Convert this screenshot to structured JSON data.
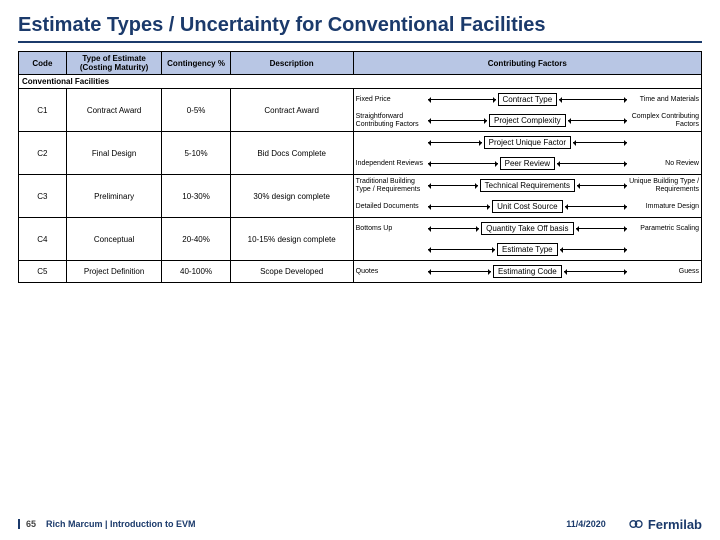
{
  "slide": {
    "title": "Estimate Types / Uncertainty for Conventional Facilities",
    "table": {
      "headers": [
        "Code",
        "Type of Estimate (Costing Maturity)",
        "Contingency %",
        "Description",
        "Contributing Factors"
      ],
      "section_heading": "Conventional Facilities",
      "rows": [
        {
          "code": "C1",
          "type": "Contract Award",
          "cont": "0-5%",
          "desc": "Contract Award"
        },
        {
          "code": "C2",
          "type": "Final Design",
          "cont": "5-10%",
          "desc": "Bid Docs Complete"
        },
        {
          "code": "C3",
          "type": "Preliminary",
          "cont": "10-30%",
          "desc": "30% design complete"
        },
        {
          "code": "C4",
          "type": "Conceptual",
          "cont": "20-40%",
          "desc": "10-15% design complete"
        },
        {
          "code": "C5",
          "type": "Project Definition",
          "cont": "40-100%",
          "desc": "Scope Developed"
        }
      ],
      "factor_rows": [
        {
          "label_left": "Fixed Price",
          "label_right": "Time and Materials",
          "mid": "Contract Type"
        },
        {
          "label_left": "Straightforward Contributing Factors",
          "label_right": "Complex Contributing Factors",
          "mid": "Project Complexity"
        },
        {
          "label_left": "",
          "label_right": "",
          "mid": "Project Unique Factor"
        },
        {
          "label_left": "Independent Reviews",
          "label_right": "No Review",
          "mid": "Peer Review"
        },
        {
          "label_left": "Traditional Building Type / Requirements",
          "label_right": "Unique Building Type / Requirements",
          "mid": "Technical Requirements"
        },
        {
          "label_left": "Detailed Documents",
          "label_right": "Immature Design",
          "mid": "Unit Cost Source"
        },
        {
          "label_left": "Bottoms Up",
          "label_right": "Parametric Scaling",
          "mid": "Quantity Take Off basis"
        },
        {
          "label_left": "",
          "label_right": "",
          "mid": "Estimate Type"
        },
        {
          "label_left": "Quotes",
          "label_right": "Guess",
          "mid": "Estimating Code"
        }
      ]
    }
  },
  "footer": {
    "page": "65",
    "presenter": "Rich Marcum | Introduction to EVM",
    "date": "11/4/2020",
    "brand": "Fermilab"
  }
}
